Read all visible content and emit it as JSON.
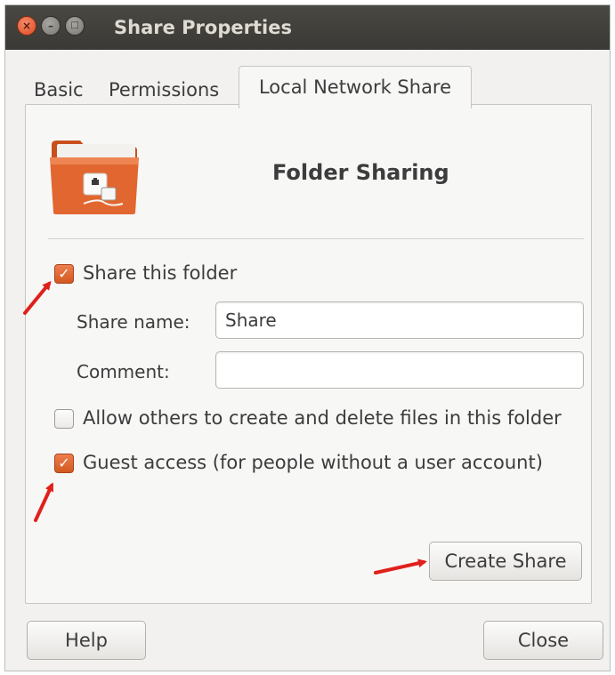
{
  "window": {
    "title": "Share Properties"
  },
  "window_buttons": {
    "close_glyph": "×",
    "minimize_glyph": "–",
    "maximize_glyph": "□"
  },
  "tabs": [
    {
      "label": "Basic",
      "active": false
    },
    {
      "label": "Permissions",
      "active": false
    },
    {
      "label": "Local Network Share",
      "active": true
    }
  ],
  "content": {
    "heading": "Folder Sharing",
    "icon": "folder-share-icon",
    "share_checkbox": {
      "label": "Share this folder",
      "checked": true
    },
    "share_name": {
      "label": "Share name:",
      "value": "Share"
    },
    "comment": {
      "label": "Comment:",
      "value": ""
    },
    "allow_others": {
      "label": "Allow others to create and delete files in this folder",
      "checked": false
    },
    "guest_access": {
      "label": "Guest access (for people without a user account)",
      "checked": true
    },
    "create_button": "Create Share"
  },
  "footer": {
    "help_label": "Help",
    "close_label": "Close"
  },
  "colors": {
    "accent": "#dd5a21",
    "annotation": "#e0201b",
    "titlebar": "#3c3b37"
  }
}
